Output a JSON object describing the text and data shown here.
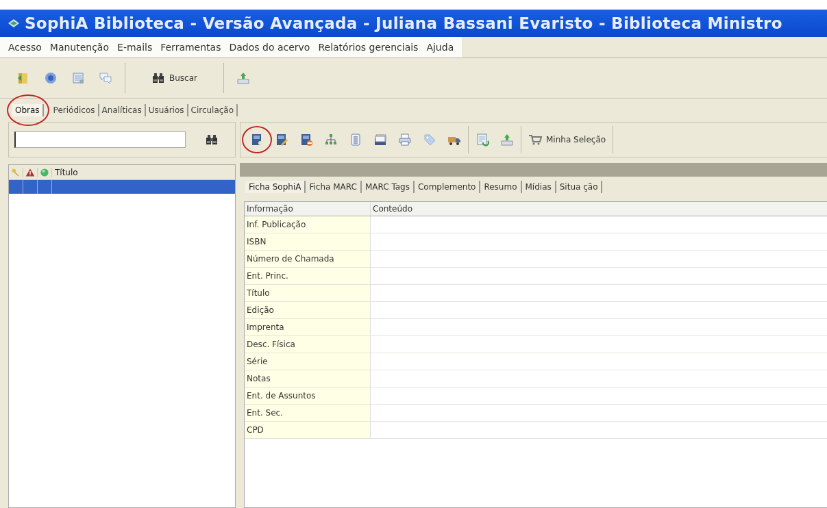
{
  "window": {
    "title": "SophiA Biblioteca - Versão Avançada - Juliana Bassani Evaristo - Biblioteca Ministro"
  },
  "menu": [
    "Acesso",
    "Manutenção",
    "E-mails",
    "Ferramentas",
    "Dados do acervo",
    "Relatórios gerenciais",
    "Ajuda"
  ],
  "main_toolbar": [
    {
      "kind": "icon"
    },
    {
      "kind": "icon"
    },
    {
      "kind": "icon"
    },
    {
      "kind": "icon"
    },
    {
      "kind": "separator"
    },
    {
      "kind": "labeled",
      "label": "Buscar"
    },
    {
      "kind": "separator"
    },
    {
      "kind": "icon"
    }
  ],
  "tabs": [
    {
      "label": "Obras",
      "selected": true,
      "circled": true
    },
    {
      "label": "Periódicos",
      "selected": false,
      "circled": false
    },
    {
      "label": "Analíticas",
      "selected": false,
      "circled": false
    },
    {
      "label": "Usuários",
      "selected": false,
      "circled": false
    },
    {
      "label": "Circulação",
      "selected": false,
      "circled": false
    }
  ],
  "list": {
    "columns": [
      {
        "kind": "icon"
      },
      {
        "kind": "icon"
      },
      {
        "kind": "icon"
      },
      {
        "kind": "text",
        "label": "Título"
      }
    ],
    "rows": [
      {
        "selected": true
      }
    ]
  },
  "record_toolbar": [
    {
      "kind": "icon",
      "circled": true
    },
    {
      "kind": "icon",
      "circled": false
    },
    {
      "kind": "icon",
      "circled": false
    },
    {
      "kind": "icon",
      "circled": false
    },
    {
      "kind": "icon",
      "circled": false
    },
    {
      "kind": "icon",
      "circled": false
    },
    {
      "kind": "icon",
      "circled": false
    },
    {
      "kind": "icon",
      "circled": false
    },
    {
      "kind": "icon",
      "circled": false
    },
    {
      "kind": "separator"
    },
    {
      "kind": "icon",
      "circled": false
    },
    {
      "kind": "icon",
      "circled": false
    },
    {
      "kind": "separator"
    },
    {
      "kind": "labeled",
      "label": "Minha Seleção",
      "circled": false
    },
    {
      "kind": "separator"
    }
  ],
  "record_tabs": [
    {
      "label": "Ficha SophiA",
      "selected": true
    },
    {
      "label": "Ficha MARC",
      "selected": false
    },
    {
      "label": "MARC Tags",
      "selected": false
    },
    {
      "label": "Complemento",
      "selected": false
    },
    {
      "label": "Resumo",
      "selected": false
    },
    {
      "label": "Mídias",
      "selected": false
    },
    {
      "label": "Situa ção",
      "selected": false
    }
  ],
  "grid": {
    "columns": [
      "Informação",
      "Conteúdo"
    ],
    "rows": [
      "Inf. Publicação",
      "ISBN",
      "Número de Chamada",
      "Ent. Princ.",
      "Título",
      "Edição",
      "Imprenta",
      "Desc. Física",
      "Série",
      "Notas",
      "Ent. de Assuntos",
      "Ent. Sec.",
      "CPD"
    ]
  }
}
